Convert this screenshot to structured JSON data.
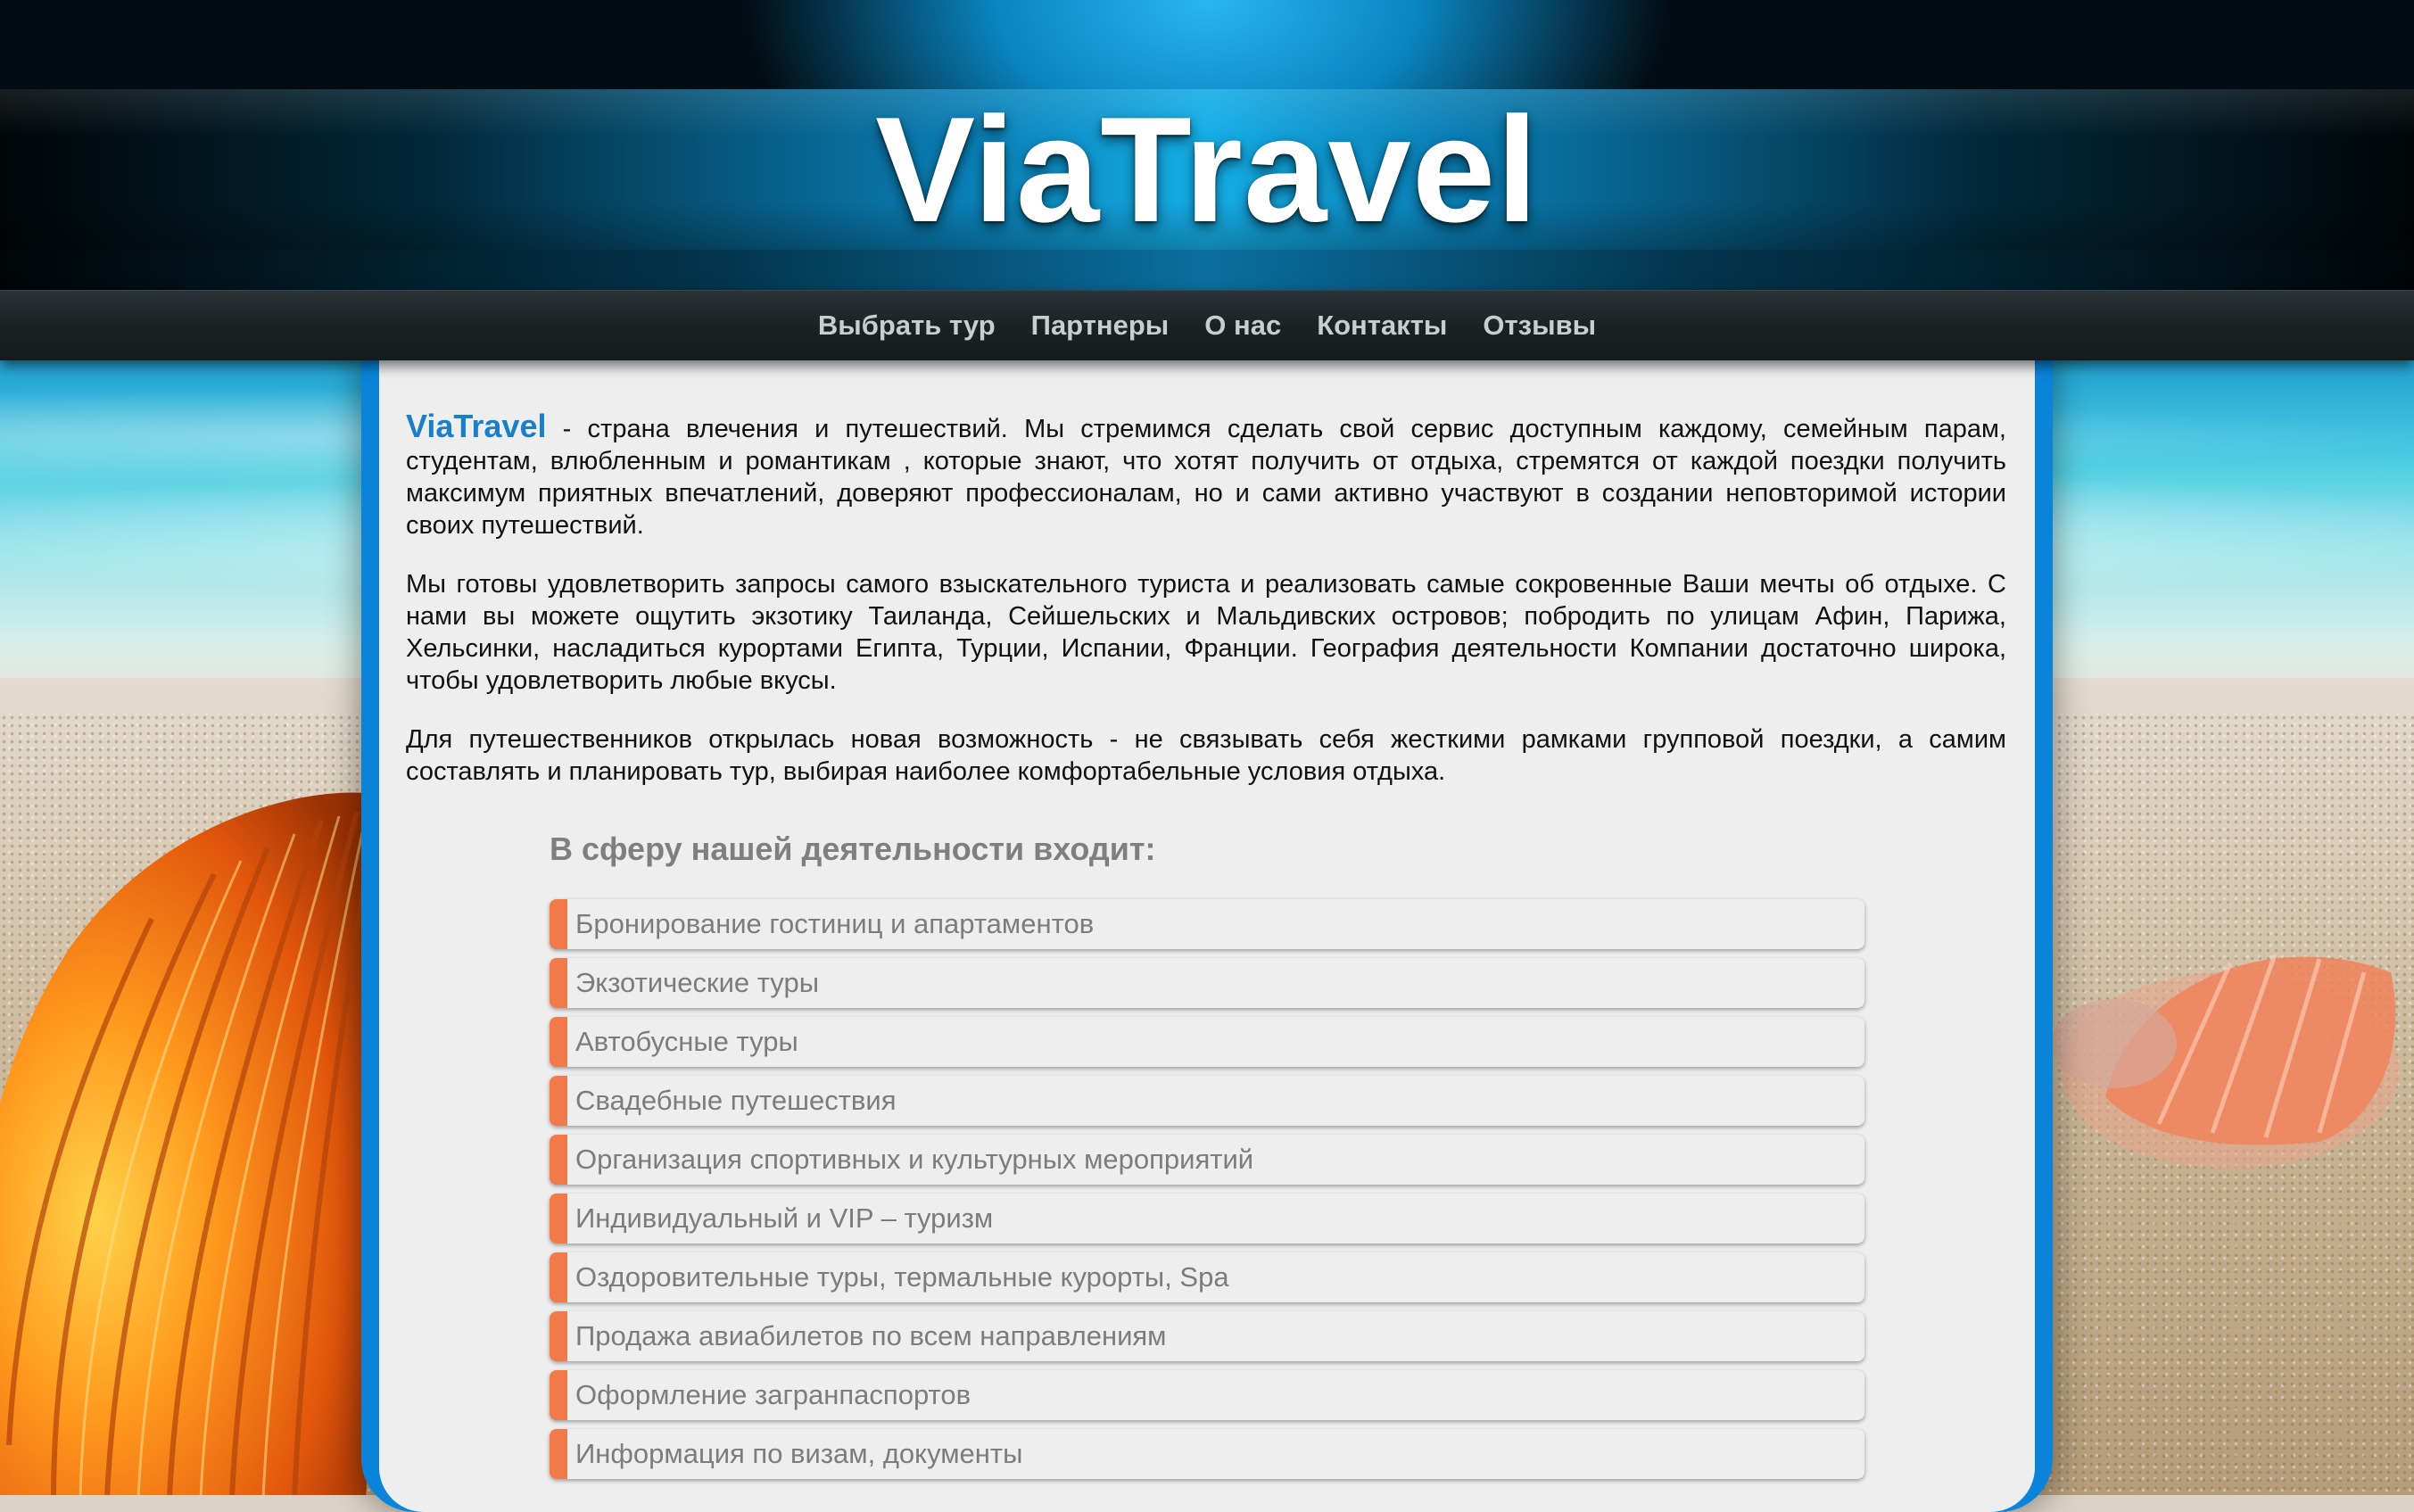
{
  "site": {
    "logo_text": "ViaTravel"
  },
  "nav": {
    "items": [
      {
        "label": "Выбрать тур"
      },
      {
        "label": "Партнеры"
      },
      {
        "label": "О нас"
      },
      {
        "label": "Контакты"
      },
      {
        "label": "Отзывы"
      }
    ]
  },
  "intro": {
    "brand": "ViaTravel",
    "p1_rest": " - страна влечения и путешествий. Мы стремимся сделать свой сервис доступным каждому, семейным парам, студентам, влюбленным и романтикам , которые знают, что хотят получить от отдыха, стремятся от каждой поездки получить максимум приятных впечатлений, доверяют профессионалам, но и сами активно участвуют в создании неповторимой истории своих путешествий.",
    "p2": "Мы готовы удовлетворить запросы самого взыскательного туриста и реализовать самые сокровенные Ваши мечты об отдыхе. С нами вы можете ощутить экзотику Таиланда, Сейшельских и Мальдивских островов; побродить по улицам Афин, Парижа, Хельсинки, насладиться курортами Египта, Турции, Испании, Франции. География деятельности Компании достаточно широка, чтобы удовлетворить любые вкусы.",
    "p3": "Для путешественников открылась новая возможность - не связывать себя жесткими рамками групповой поездки, а самим составлять и планировать тур, выбирая наиболее комфортабельные условия отдыха."
  },
  "services": {
    "heading": "В сферу нашей деятельности входит:",
    "items": [
      "Бронирование гостиниц и апартаментов",
      "Экзотические туры",
      "Автобусные туры",
      "Свадебные путешествия",
      "Организация спортивных и культурных мероприятий",
      "Индивидуальный и VIP – туризм",
      "Оздоровительные туры, термальные курорты, Spa",
      "Продажа авиабилетов по всем направлениям",
      "Оформление загранпаспортов",
      "Информация по визам, документы"
    ]
  },
  "colors": {
    "accent_blue": "#1a7fc8",
    "panel_border": "#1b9be8",
    "list_marker": "#f07a4a",
    "nav_text": "#c8cdcf"
  }
}
